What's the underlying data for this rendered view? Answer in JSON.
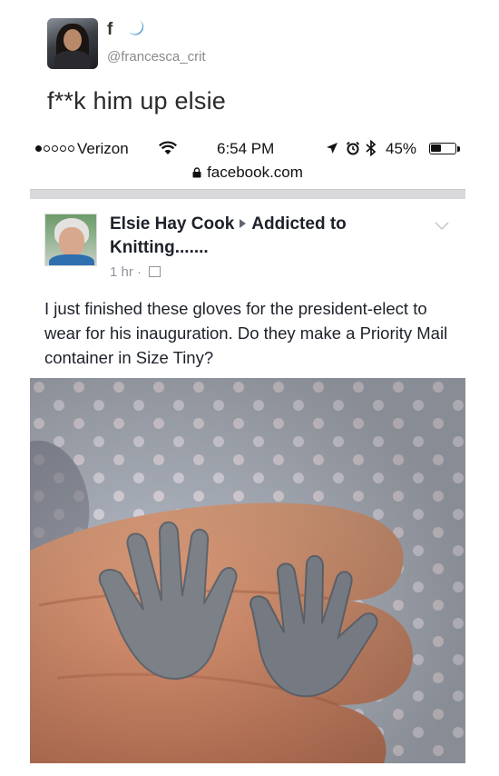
{
  "tweet": {
    "name": "f",
    "handle": "@francesca_crit",
    "text": "f**k him up elsie"
  },
  "phone": {
    "carrier": "Verizon",
    "time": "6:54 PM",
    "battery_pct": "45%",
    "battery_level": 0.45,
    "signal_bars_filled": 1,
    "signal_bars_total": 5,
    "url": "facebook.com"
  },
  "post": {
    "author": "Elsie Hay Cook",
    "group": "Addicted to Knitting.......",
    "time": "1 hr",
    "separator": "·",
    "text": "I just finished these gloves for the president-elect to wear for his inauguration. Do they make a Priority Mail container in Size Tiny?"
  },
  "icons": [
    "moon-icon",
    "wifi-icon",
    "location-arrow-icon",
    "alarm-icon",
    "bluetooth-icon",
    "battery-icon",
    "lock-icon",
    "friends-icon",
    "chevron-down-icon"
  ],
  "colors": {
    "fb_text": "#1d2129",
    "meta_gray": "#90949c",
    "yarn_gray": "#7c8188"
  }
}
